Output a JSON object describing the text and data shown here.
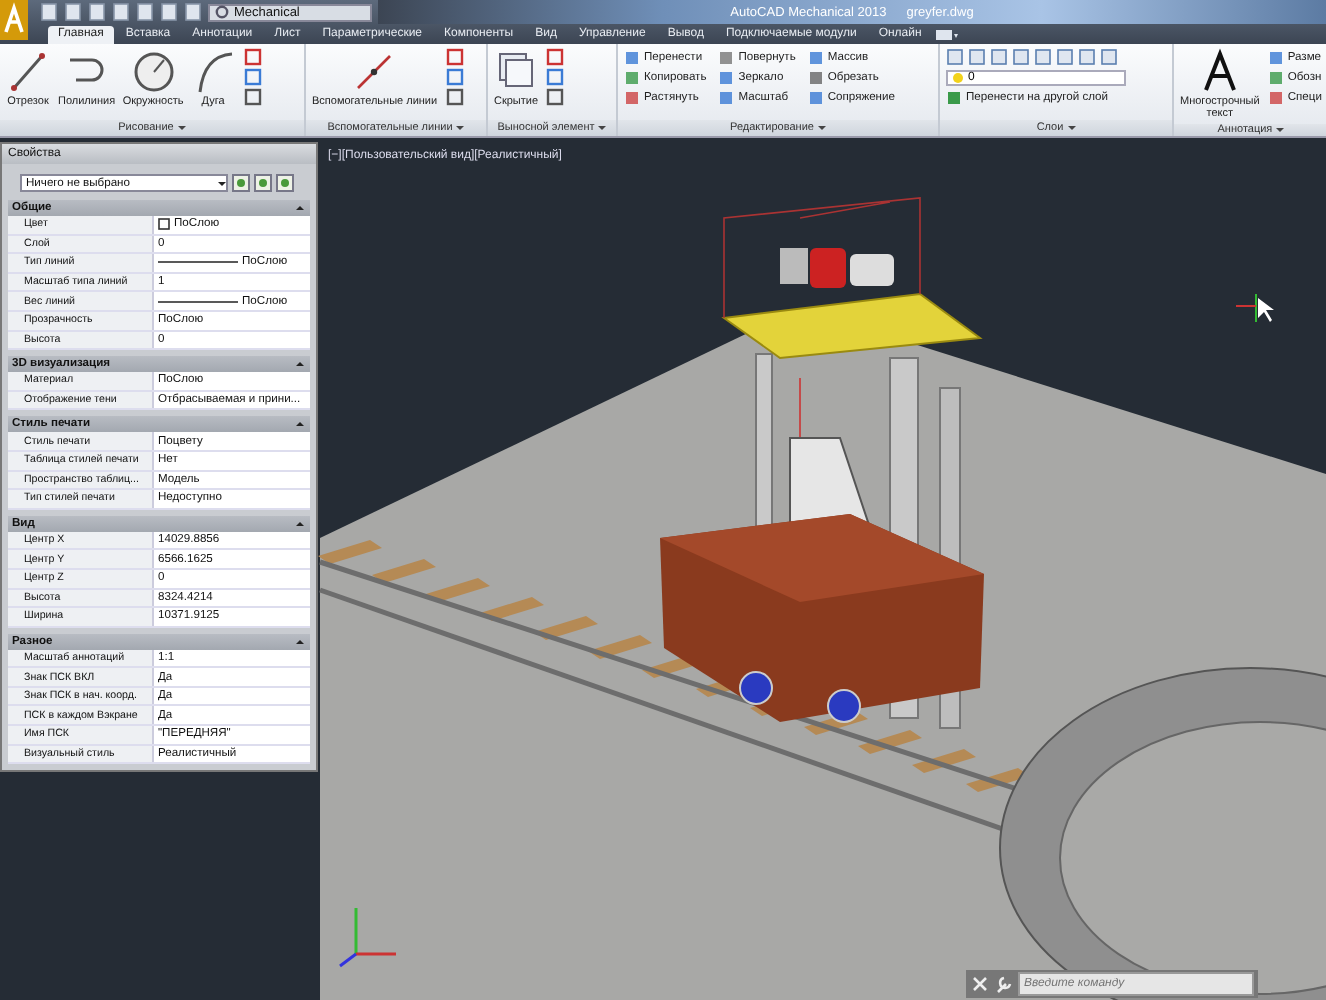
{
  "window": {
    "title": "AutoCAD Mechanical 2013",
    "file": "greyfer.dwg",
    "workspace": "Mechanical"
  },
  "tabs": [
    {
      "label": "Главная",
      "selected": true
    },
    {
      "label": "Вставка",
      "selected": false
    },
    {
      "label": "Аннотации",
      "selected": false
    },
    {
      "label": "Лист",
      "selected": false
    },
    {
      "label": "Параметрические",
      "selected": false
    },
    {
      "label": "Компоненты",
      "selected": false
    },
    {
      "label": "Вид",
      "selected": false
    },
    {
      "label": "Управление",
      "selected": false
    },
    {
      "label": "Вывод",
      "selected": false
    },
    {
      "label": "Подключаемые модули",
      "selected": false
    },
    {
      "label": "Онлайн",
      "selected": false
    }
  ],
  "ribbon": [
    {
      "title": "Рисование",
      "large": [
        "Отрезок",
        "Полилиния",
        "Окружность",
        "Дуга"
      ]
    },
    {
      "title": "Вспомогательные линии",
      "large": [
        "Вспомогательные линии"
      ]
    },
    {
      "title": "Выносной элемент",
      "large": [
        "Скрытие"
      ]
    },
    {
      "title": "Редактирование",
      "small": [
        "Перенести",
        "Копировать",
        "Растянуть",
        "Повернуть",
        "Зеркало",
        "Масштаб",
        "Массив",
        "Обрезать",
        "Сопряжение"
      ]
    },
    {
      "title": "Слои",
      "layer": "0",
      "action": "Перенести на другой слой"
    },
    {
      "title": "Аннотация",
      "large": [
        "Многострочный текст"
      ],
      "small": [
        "Разме",
        "Обозн",
        "Специ"
      ]
    }
  ],
  "properties": {
    "title": "Свойства",
    "selection": "Ничего не выбрано",
    "sections": [
      {
        "title": "Общие",
        "rows": [
          {
            "label": "Цвет",
            "value": "ПоСлою",
            "kind": "swatch"
          },
          {
            "label": "Слой",
            "value": "0",
            "kind": "text"
          },
          {
            "label": "Тип линий",
            "value": "ПоСлою",
            "kind": "line"
          },
          {
            "label": "Масштаб типа линий",
            "value": "1",
            "kind": "text"
          },
          {
            "label": "Вес линий",
            "value": "ПоСлою",
            "kind": "line"
          },
          {
            "label": "Прозрачность",
            "value": "ПоСлою",
            "kind": "text"
          },
          {
            "label": "Высота",
            "value": "0",
            "kind": "text"
          }
        ]
      },
      {
        "title": "3D визуализация",
        "rows": [
          {
            "label": "Материал",
            "value": "ПоСлою",
            "kind": "text"
          },
          {
            "label": "Отображение тени",
            "value": "Отбрасываемая и прини...",
            "kind": "text"
          }
        ]
      },
      {
        "title": "Стиль печати",
        "rows": [
          {
            "label": "Стиль печати",
            "value": "Поцвету",
            "kind": "text"
          },
          {
            "label": "Таблица стилей печати",
            "value": "Нет",
            "kind": "text"
          },
          {
            "label": "Пространство таблиц...",
            "value": "Модель",
            "kind": "text"
          },
          {
            "label": "Тип стилей печати",
            "value": "Недоступно",
            "kind": "text"
          }
        ]
      },
      {
        "title": "Вид",
        "rows": [
          {
            "label": "Центр X",
            "value": "14029.8856",
            "kind": "text"
          },
          {
            "label": "Центр Y",
            "value": "6566.1625",
            "kind": "text"
          },
          {
            "label": "Центр Z",
            "value": "0",
            "kind": "text"
          },
          {
            "label": "Высота",
            "value": "8324.4214",
            "kind": "text"
          },
          {
            "label": "Ширина",
            "value": "10371.9125",
            "kind": "text"
          }
        ]
      },
      {
        "title": "Разное",
        "rows": [
          {
            "label": "Масштаб аннотаций",
            "value": "1:1",
            "kind": "text"
          },
          {
            "label": "Знак ПСК ВКЛ",
            "value": "Да",
            "kind": "text"
          },
          {
            "label": "Знак ПСК в нач. коорд.",
            "value": "Да",
            "kind": "text"
          },
          {
            "label": "ПСК в каждом Вэкране",
            "value": "Да",
            "kind": "text"
          },
          {
            "label": "Имя ПСК",
            "value": "\"ПЕРЕДНЯЯ\"",
            "kind": "text"
          },
          {
            "label": "Визуальный стиль",
            "value": "Реалистичный",
            "kind": "text"
          }
        ]
      }
    ]
  },
  "viewport": {
    "label": "[−][Пользовательский вид][Реалистичный]"
  },
  "command_line": {
    "placeholder": "Введите команду"
  }
}
